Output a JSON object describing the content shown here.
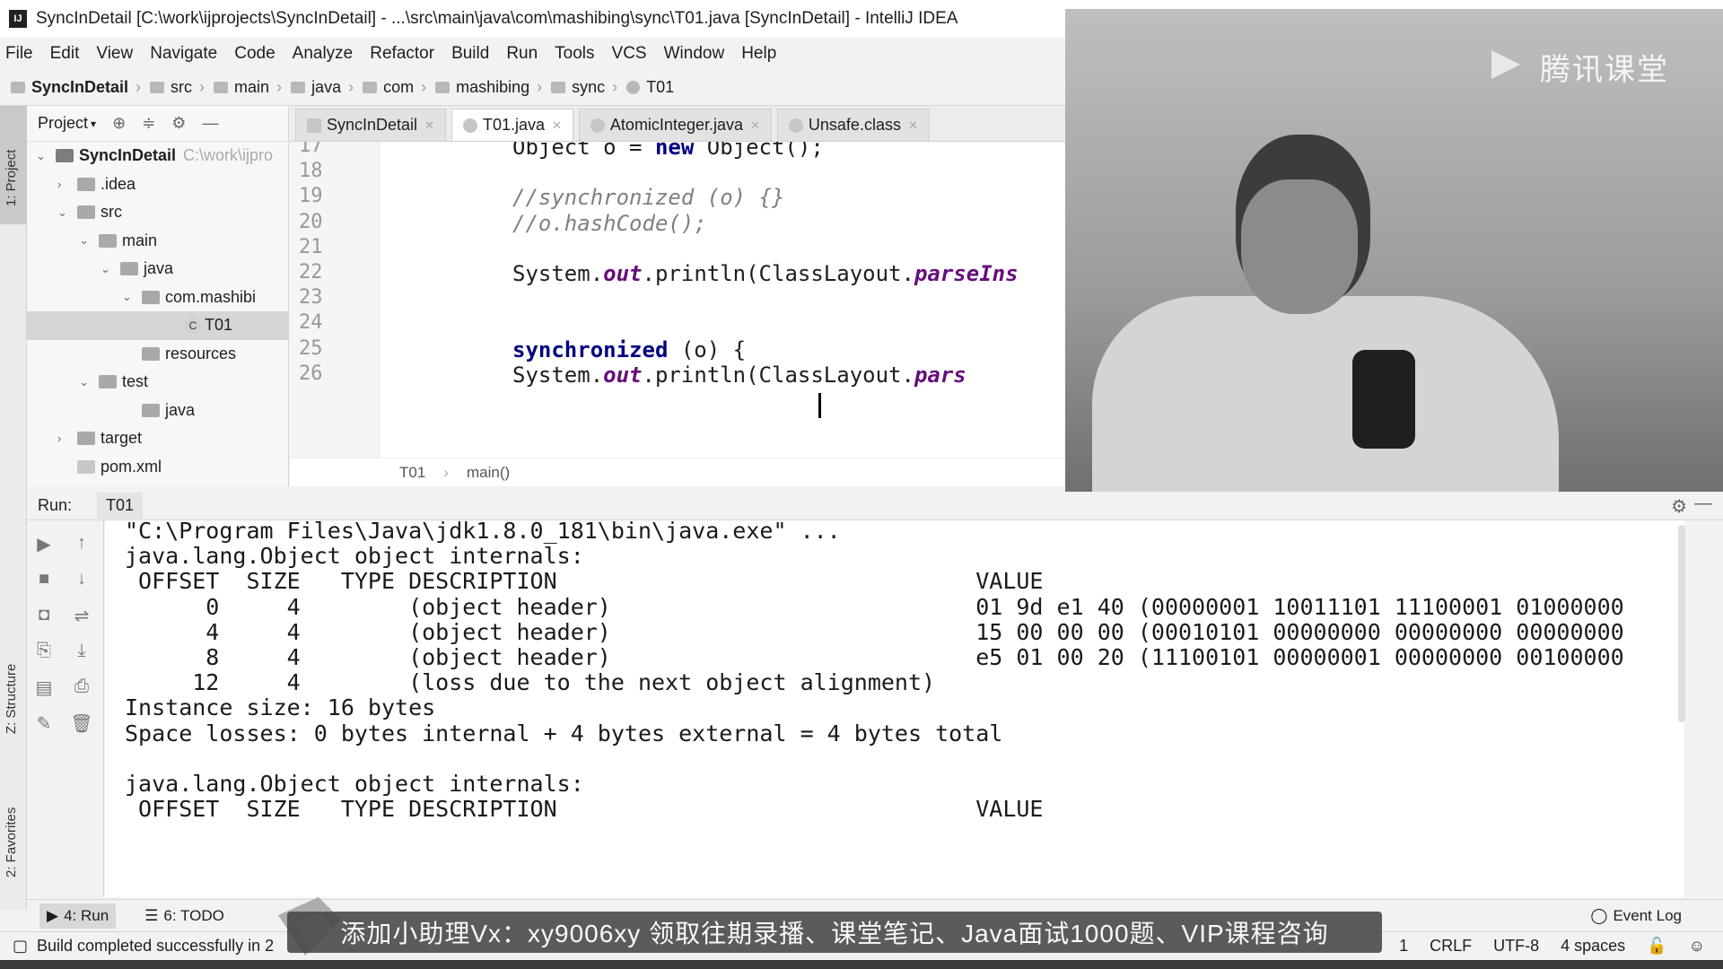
{
  "window": {
    "title": "SyncInDetail [C:\\work\\ijprojects\\SyncInDetail] - ...\\src\\main\\java\\com\\mashibing\\sync\\T01.java [SyncInDetail] - IntelliJ IDEA",
    "app_icon": "IJ"
  },
  "menu": [
    "File",
    "Edit",
    "View",
    "Navigate",
    "Code",
    "Analyze",
    "Refactor",
    "Build",
    "Run",
    "Tools",
    "VCS",
    "Window",
    "Help"
  ],
  "breadcrumbs": [
    "SyncInDetail",
    "src",
    "main",
    "java",
    "com",
    "mashibing",
    "sync",
    "T01"
  ],
  "left_strip": {
    "project": "1: Project",
    "structure": "Z: Structure",
    "favorites": "2: Favorites"
  },
  "project_panel": {
    "title": "Project",
    "tree": [
      {
        "label": "SyncInDetail",
        "extra": "C:\\work\\ijpro",
        "depth": 0,
        "expanded": true,
        "kind": "module"
      },
      {
        "label": ".idea",
        "depth": 1,
        "expanded": false,
        "kind": "folder"
      },
      {
        "label": "src",
        "depth": 1,
        "expanded": true,
        "kind": "folder"
      },
      {
        "label": "main",
        "depth": 2,
        "expanded": true,
        "kind": "folder"
      },
      {
        "label": "java",
        "depth": 3,
        "expanded": true,
        "kind": "folder"
      },
      {
        "label": "com.mashibi",
        "depth": 4,
        "expanded": true,
        "kind": "folder"
      },
      {
        "label": "T01",
        "depth": 6,
        "kind": "class",
        "selected": true
      },
      {
        "label": "resources",
        "depth": 4,
        "kind": "folder"
      },
      {
        "label": "test",
        "depth": 2,
        "expanded": true,
        "kind": "folder"
      },
      {
        "label": "java",
        "depth": 4,
        "kind": "folder"
      },
      {
        "label": "target",
        "depth": 1,
        "expanded": false,
        "kind": "folder"
      },
      {
        "label": "pom.xml",
        "depth": 1,
        "kind": "file"
      }
    ]
  },
  "tabs": [
    {
      "label": "SyncInDetail",
      "active": false
    },
    {
      "label": "T01.java",
      "active": true
    },
    {
      "label": "AtomicInteger.java",
      "active": false
    },
    {
      "label": "Unsafe.class",
      "active": false
    }
  ],
  "editor": {
    "lines": [
      {
        "num": "17",
        "parts": [
          [
            "plain",
            "Object o = "
          ],
          [
            "kw",
            "new"
          ],
          [
            "plain",
            " Object();"
          ]
        ]
      },
      {
        "num": "18",
        "parts": []
      },
      {
        "num": "19",
        "parts": [
          [
            "cm",
            "//synchronized (o) {}"
          ]
        ]
      },
      {
        "num": "20",
        "parts": [
          [
            "cm",
            "//o.hashCode();"
          ]
        ]
      },
      {
        "num": "21",
        "parts": []
      },
      {
        "num": "22",
        "parts": [
          [
            "plain",
            "System."
          ],
          [
            "it",
            "out"
          ],
          [
            "plain",
            ".println(ClassLayout."
          ],
          [
            "it",
            "parseIns"
          ]
        ]
      },
      {
        "num": "23",
        "parts": []
      },
      {
        "num": "24",
        "parts": []
      },
      {
        "num": "25",
        "parts": [
          [
            "kw",
            "synchronized"
          ],
          [
            "plain",
            " (o) {"
          ]
        ]
      },
      {
        "num": "26",
        "parts": [
          [
            "plain",
            "    System."
          ],
          [
            "it",
            "out"
          ],
          [
            "plain",
            ".println(ClassLayout."
          ],
          [
            "it",
            "pars"
          ]
        ]
      }
    ],
    "breadcrumb": [
      "T01",
      "main()"
    ]
  },
  "webcam": {
    "watermark": "腾讯课堂"
  },
  "run_panel": {
    "label": "Run:",
    "tab": "T01",
    "console": [
      "\"C:\\Program Files\\Java\\jdk1.8.0_181\\bin\\java.exe\" ...",
      "java.lang.Object object internals:",
      " OFFSET  SIZE   TYPE DESCRIPTION                               VALUE",
      "      0     4        (object header)                           01 9d e1 40 (00000001 10011101 11100001 01000000",
      "      4     4        (object header)                           15 00 00 00 (00010101 00000000 00000000 00000000",
      "      8     4        (object header)                           e5 01 00 20 (11100101 00000001 00000000 00100000",
      "     12     4        (loss due to the next object alignment)",
      "Instance size: 16 bytes",
      "Space losses: 0 bytes internal + 4 bytes external = 4 bytes total",
      "",
      "java.lang.Object object internals:",
      " OFFSET  SIZE   TYPE DESCRIPTION                               VALUE"
    ]
  },
  "toolwindows": {
    "run": "4: Run",
    "todo": "6: TODO",
    "event_log": "Event Log"
  },
  "status": {
    "message": "Build completed successfully in 2",
    "position": "1",
    "line_sep": "CRLF",
    "encoding": "UTF-8",
    "indent": "4 spaces"
  },
  "banner": {
    "text": "添加小助理Vx：xy9006xy 领取往期录播、课堂笔记、Java面试1000题、VIP课程咨询"
  }
}
